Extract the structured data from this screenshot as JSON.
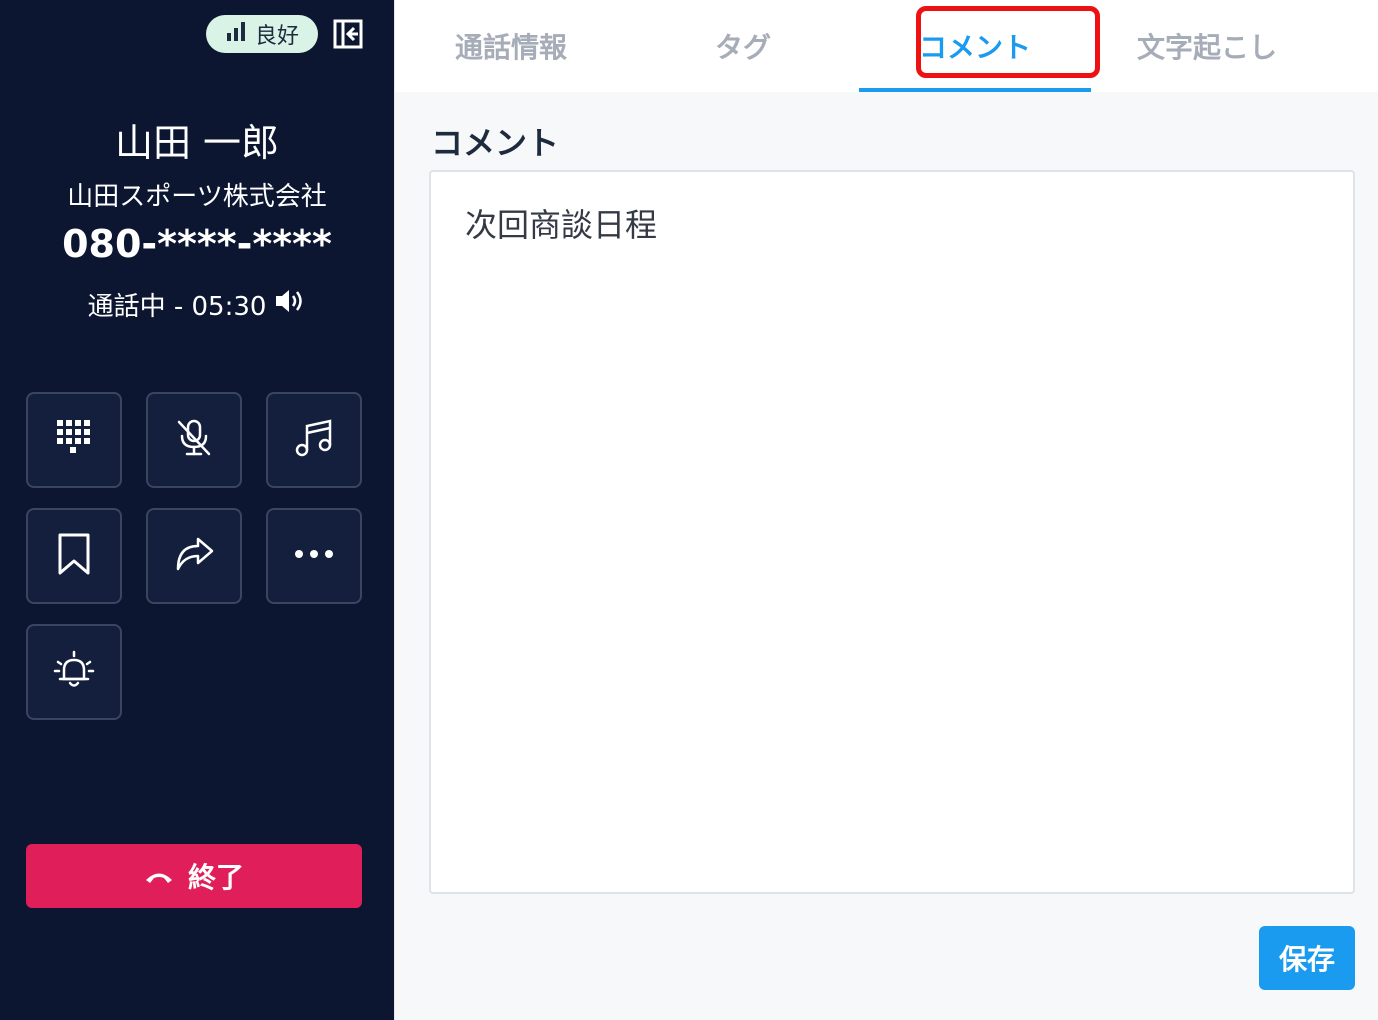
{
  "status": {
    "signal_label": "良好"
  },
  "caller": {
    "name": "山田 一郎",
    "company": "山田スポーツ株式会社",
    "phone": "080-****-****",
    "status_text": "通話中 - 05:30"
  },
  "controls": [
    {
      "icon": "dialpad-icon"
    },
    {
      "icon": "mic-off-icon"
    },
    {
      "icon": "music-note-icon"
    },
    {
      "icon": "bookmark-icon"
    },
    {
      "icon": "forward-icon"
    },
    {
      "icon": "more-icon"
    },
    {
      "icon": "alarm-bell-icon"
    }
  ],
  "end_call": {
    "label": "終了"
  },
  "tabs": [
    {
      "label": "通話情報",
      "active": false
    },
    {
      "label": "タグ",
      "active": false
    },
    {
      "label": "コメント",
      "active": true
    },
    {
      "label": "文字起こし",
      "active": false
    }
  ],
  "comment": {
    "section_title": "コメント",
    "value": "次回商談日程",
    "save_label": "保存"
  },
  "colors": {
    "panel_bg": "#0c1631",
    "accent": "#1a9bf0",
    "danger": "#e01e5a",
    "signal_bg": "#d9f3e6",
    "highlight": "#ee1111"
  }
}
